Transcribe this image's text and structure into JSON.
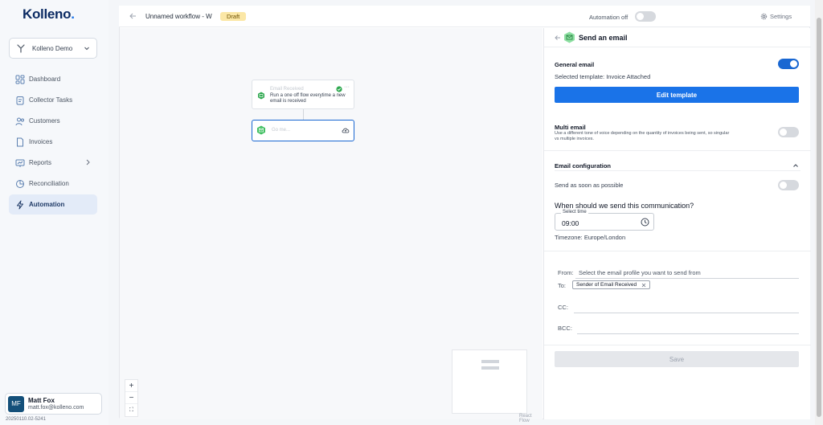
{
  "brand": {
    "logo_text": "Kolleno",
    "logo_dot": "."
  },
  "org_selector": {
    "name": "Kolleno Demo"
  },
  "sidebar": {
    "items": [
      {
        "label": "Dashboard",
        "icon": "dashboard-icon"
      },
      {
        "label": "Collector Tasks",
        "icon": "tasks-icon"
      },
      {
        "label": "Customers",
        "icon": "customers-icon"
      },
      {
        "label": "Invoices",
        "icon": "invoices-icon"
      },
      {
        "label": "Reports",
        "icon": "reports-icon",
        "has_submenu": true
      },
      {
        "label": "Reconciliation",
        "icon": "reconciliation-icon"
      },
      {
        "label": "Automation",
        "icon": "automation-icon",
        "active": true
      }
    ]
  },
  "user": {
    "initials": "MF",
    "name": "Matt Fox",
    "email": "matt.fox@kolleno.com"
  },
  "version": "20250110.02-5241",
  "topbar": {
    "workflow_name": "Unnamed workflow - W",
    "status_badge": "Draft",
    "automation_label": "Automation off",
    "automation_on": false,
    "settings_label": "Settings"
  },
  "canvas": {
    "node1": {
      "title": "Email Received",
      "description": "Run a one off flow everytime a new email is received",
      "more": "···"
    },
    "node2": {
      "title": "Go me..."
    },
    "zoom": {
      "in": "+",
      "out": "−",
      "fit": "⛶"
    },
    "attribution": "React Flow"
  },
  "panel": {
    "title": "Send an email",
    "general": {
      "label": "General email",
      "enabled": true,
      "selected_template": "Selected template: Invoice Attached",
      "edit_button": "Edit template"
    },
    "multi": {
      "label": "Multi email",
      "enabled": false,
      "description": "Use a different tone of voice depending on the quantity of invoices being sent, so singular vs multiple invoices."
    },
    "config": {
      "label": "Email configuration",
      "asap_label": "Send as soon as possible",
      "asap_enabled": false,
      "question": "When should we send this communication?",
      "time_label": "Select time",
      "time_value": "09:00",
      "timezone": "Timezone: Europe/London"
    },
    "recipients": {
      "from_label": "From:",
      "from_placeholder": "Select the email profile you want to send from",
      "to_label": "To:",
      "to_chip": "Sender of Email Received",
      "cc_label": "CC:",
      "bcc_label": "BCC:"
    },
    "save_button": "Save"
  },
  "colors": {
    "accent": "#1a73e8",
    "brand_navy": "#0c2b63",
    "draft_badge": "#fbe7a6",
    "node_green": "#2ea84f"
  }
}
